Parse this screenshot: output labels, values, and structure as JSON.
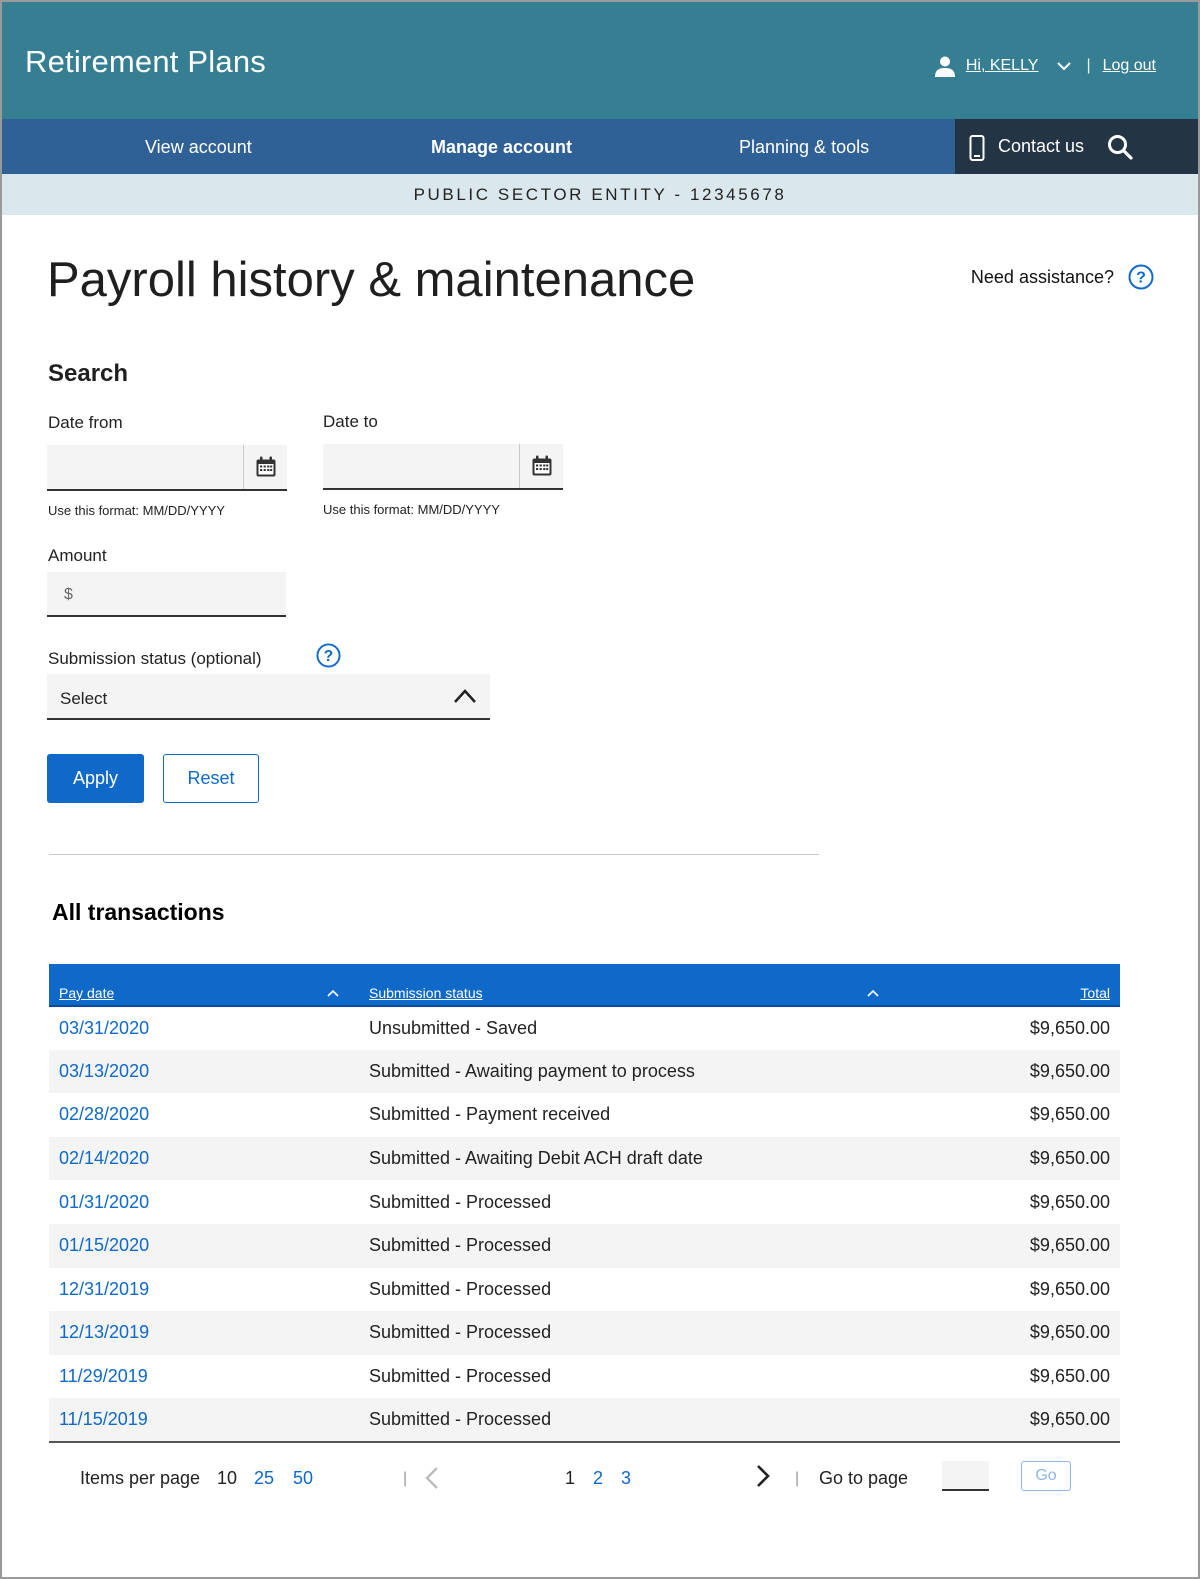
{
  "header": {
    "app_title": "Retirement Plans",
    "greeting": "Hi, KELLY",
    "separator": "|",
    "logout": "Log out"
  },
  "nav": {
    "items": [
      {
        "label": "View account"
      },
      {
        "label": "Manage account"
      },
      {
        "label": "Planning & tools"
      }
    ],
    "active": "Manage account",
    "contact": "Contact us"
  },
  "entity": "PUBLIC SECTOR ENTITY - 12345678",
  "page": {
    "title": "Payroll history & maintenance",
    "assistance": "Need assistance?"
  },
  "search": {
    "title": "Search",
    "date_from_label": "Date from",
    "date_to_label": "Date to",
    "date_from_value": "",
    "date_to_value": "",
    "date_hint": "Use this format: MM/DD/YYYY",
    "amount_label": "Amount",
    "amount_prefix": "$",
    "amount_value": "",
    "status_label": "Submission status (optional)",
    "status_value": "Select",
    "apply": "Apply",
    "reset": "Reset"
  },
  "transactions": {
    "title": "All transactions",
    "columns": {
      "pay_date": "Pay date",
      "status": "Submission status",
      "total": "Total"
    },
    "rows": [
      {
        "date": "03/31/2020",
        "status": "Unsubmitted - Saved",
        "total": "$9,650.00"
      },
      {
        "date": "03/13/2020",
        "status": "Submitted - Awaiting payment to process",
        "total": "$9,650.00"
      },
      {
        "date": "02/28/2020",
        "status": "Submitted - Payment received",
        "total": "$9,650.00"
      },
      {
        "date": "02/14/2020",
        "status": "Submitted - Awaiting Debit ACH draft date",
        "total": "$9,650.00"
      },
      {
        "date": "01/31/2020",
        "status": "Submitted - Processed",
        "total": "$9,650.00"
      },
      {
        "date": "01/15/2020",
        "status": "Submitted - Processed",
        "total": "$9,650.00"
      },
      {
        "date": "12/31/2019",
        "status": "Submitted - Processed",
        "total": "$9,650.00"
      },
      {
        "date": "12/13/2019",
        "status": "Submitted - Processed",
        "total": "$9,650.00"
      },
      {
        "date": "11/29/2019",
        "status": "Submitted - Processed",
        "total": "$9,650.00"
      },
      {
        "date": "11/15/2019",
        "status": "Submitted - Processed",
        "total": "$9,650.00"
      }
    ]
  },
  "pagination": {
    "items_per_page_label": "Items per page",
    "page_sizes": [
      "10",
      "25",
      "50"
    ],
    "selected_size": "10",
    "pages": [
      "1",
      "2",
      "3"
    ],
    "current_page": "1",
    "separator": "|",
    "goto_label": "Go to page",
    "goto_value": "",
    "go_button": "Go"
  },
  "icons": {
    "user": "user-icon",
    "dropdown": "chevron-down-icon",
    "phone": "phone-icon",
    "search": "search-icon",
    "help": "help-circle-icon",
    "calendar": "calendar-icon",
    "select_toggle": "chevron-up-icon",
    "sort": "sort-up-icon",
    "prev": "chevron-left-icon",
    "next": "chevron-right-icon"
  },
  "colors": {
    "header_bg": "#367f93",
    "nav_bg": "#306196",
    "nav_right_bg": "#233444",
    "entity_bg": "#dae8ee",
    "primary": "#0f69c9"
  }
}
